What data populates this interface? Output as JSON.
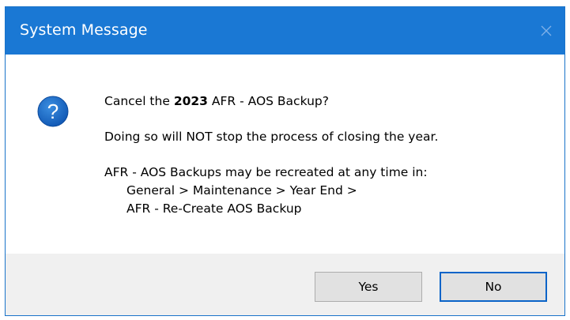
{
  "window": {
    "title": "System Message"
  },
  "message": {
    "line1_prefix": "Cancel the",
    "year": "2023",
    "line1_suffix": "AFR - AOS Backup?",
    "line2": "Doing so will NOT stop the process of closing the year.",
    "line3": "AFR - AOS Backups may be recreated at any time in:",
    "line4": "General > Maintenance > Year End >",
    "line5": "AFR - Re-Create AOS Backup"
  },
  "buttons": {
    "yes_label": "Yes",
    "no_label": "No"
  },
  "icons": {
    "dialog_icon": "question-icon",
    "close_icon": "close-icon"
  },
  "colors": {
    "titlebar": "#1a78d4",
    "question_icon": "#1565c0",
    "default_button_border": "#0a64c8"
  }
}
